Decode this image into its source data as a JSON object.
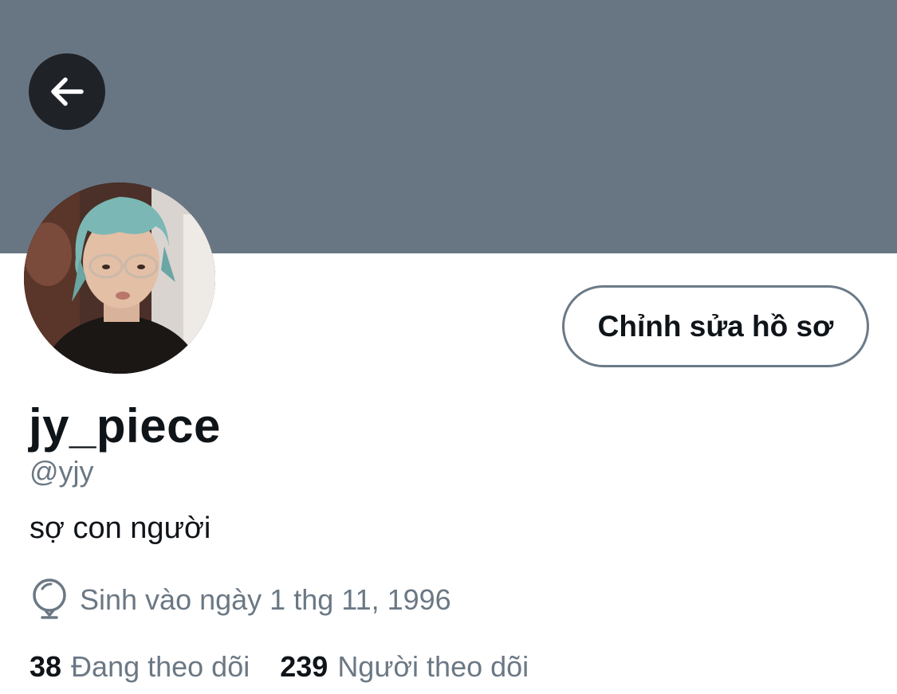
{
  "profile": {
    "display_name": "jy_piece",
    "handle": "@yjy",
    "bio": "sợ con người",
    "birth": "Sinh vào ngày 1 thg 11, 1996",
    "edit_button_label": "Chỉnh sửa hồ sơ",
    "following": {
      "count": "38",
      "label": "Đang theo dõi"
    },
    "followers": {
      "count": "239",
      "label": "Người theo dõi"
    }
  },
  "icons": {
    "back": "arrow-left-icon",
    "birth": "balloon-icon"
  },
  "colors": {
    "banner": "#687684",
    "text_primary": "#0f1419",
    "text_secondary": "#6b7884",
    "back_button": "#1f2328"
  }
}
